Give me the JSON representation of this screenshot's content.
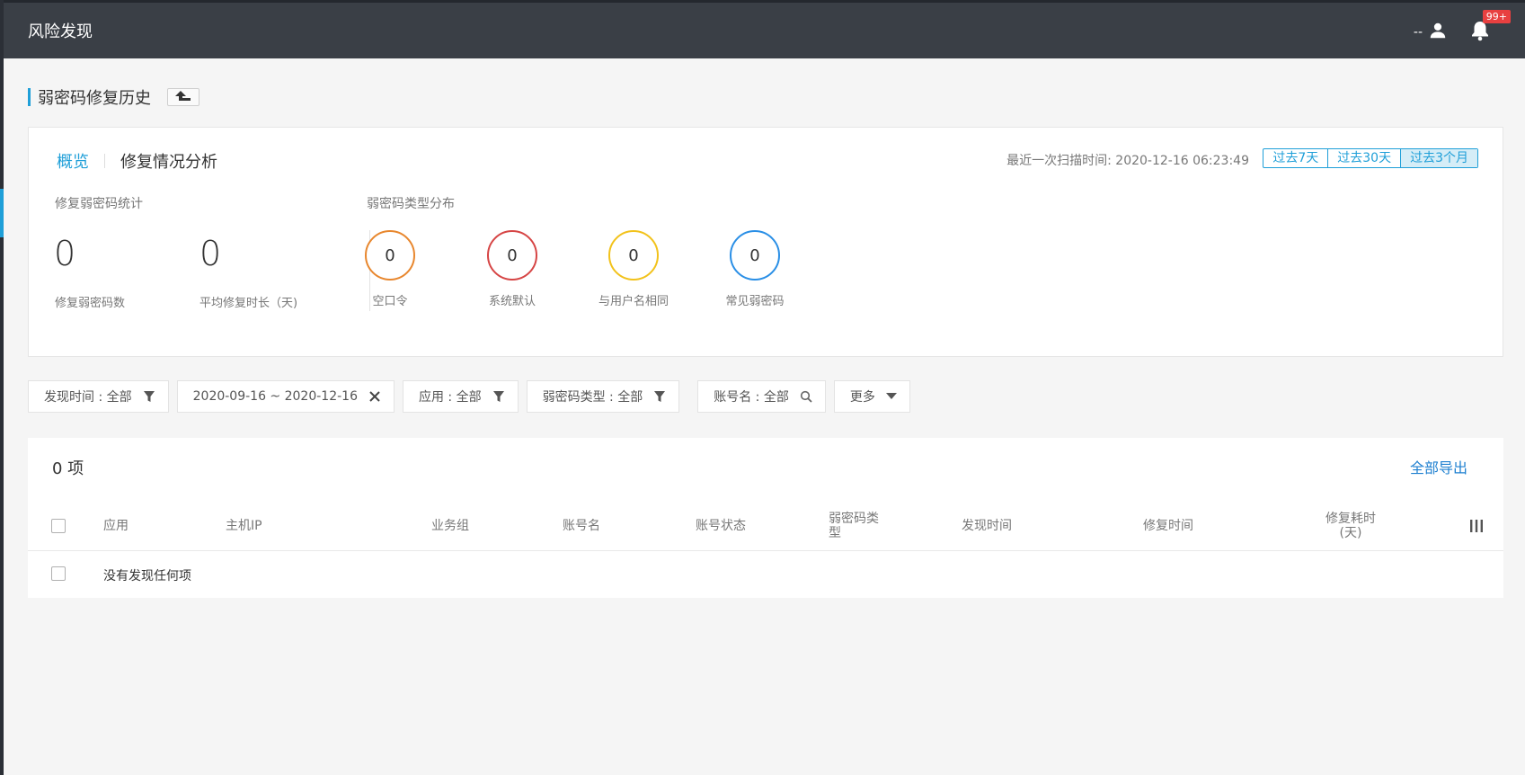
{
  "app": {
    "title": "风险发现"
  },
  "topbar": {
    "user_name": "--",
    "notification_badge": "99+"
  },
  "page": {
    "title": "弱密码修复历史"
  },
  "overview": {
    "tabs": [
      {
        "label": "概览",
        "active": true
      },
      {
        "label": "修复情况分析",
        "active": false
      }
    ],
    "last_scan": "最近一次扫描时间:  2020-12-16 06:23:49",
    "ranges": [
      {
        "label": "过去7天",
        "active": false
      },
      {
        "label": "过去30天",
        "active": false
      },
      {
        "label": "过去3个月",
        "active": true
      }
    ],
    "stats_title": "修复弱密码统计",
    "stats": [
      {
        "value": "0",
        "label": "修复弱密码数"
      },
      {
        "value": "0",
        "label": "平均修复时长（天)"
      }
    ],
    "dist_title": "弱密码类型分布",
    "distribution": [
      {
        "value": "0",
        "label": "空口令",
        "color": "#e8872e"
      },
      {
        "value": "0",
        "label": "系统默认",
        "color": "#d64545"
      },
      {
        "value": "0",
        "label": "与用户名相同",
        "color": "#f2c21b"
      },
      {
        "value": "0",
        "label": "常见弱密码",
        "color": "#2a8fe6"
      }
    ]
  },
  "filters": {
    "discover_time": "发现时间 : 全部",
    "date_range": "2020-09-16 ~ 2020-12-16",
    "app": "应用 : 全部",
    "pwd_type": "弱密码类型 : 全部",
    "account": "账号名 : 全部",
    "more": "更多"
  },
  "table": {
    "count": "0 项",
    "export": "全部导出",
    "headers": {
      "app": "应用",
      "host_ip": "主机IP",
      "group": "业务组",
      "account": "账号名",
      "account_status": "账号状态",
      "pwd_type_1": "弱密码类",
      "pwd_type_2": "型",
      "discover_time": "发现时间",
      "fix_time": "修复时间",
      "fix_cost_1": "修复耗时",
      "fix_cost_2": "(天)"
    },
    "empty": "没有发现任何项"
  },
  "colors": {
    "accent": "#1f9fd8",
    "topbar": "#3a3f46",
    "link": "#1f80d0",
    "badge": "#e84040"
  }
}
